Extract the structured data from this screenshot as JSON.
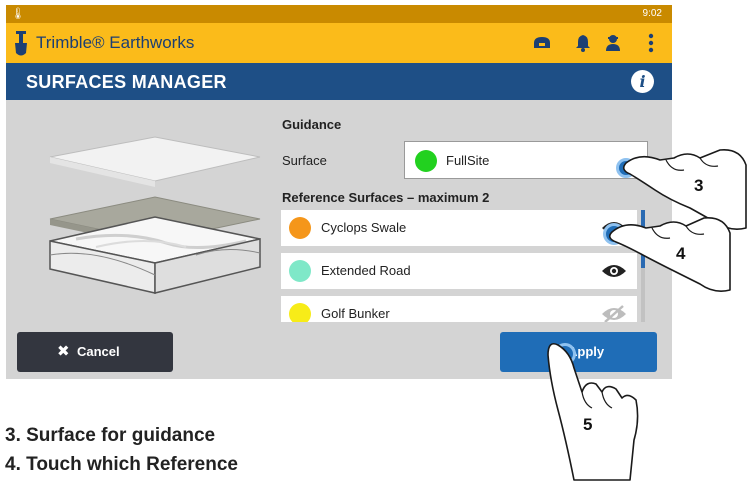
{
  "status_bar": {
    "time": "9:02"
  },
  "app_bar": {
    "title": "Trimble® Earthworks",
    "icons": [
      "scanner-icon",
      "bell-icon",
      "person-icon",
      "kebab-menu-icon"
    ]
  },
  "header": {
    "title": "SURFACES MANAGER",
    "info_icon": "info-icon",
    "info_glyph": "i"
  },
  "guidance": {
    "section_title": "Guidance",
    "surface_label": "Surface",
    "surface_value": "FullSite",
    "surface_color": "#22d11f"
  },
  "references": {
    "section_title": "Reference Surfaces – maximum 2",
    "items": [
      {
        "name": "Cyclops Swale",
        "color": "#f5961a",
        "visibility": "visible"
      },
      {
        "name": "Extended Road",
        "color": "#7fe8c8",
        "visibility": "visible"
      },
      {
        "name": "Golf Bunker",
        "color": "#f7ec18",
        "visibility": "hidden"
      }
    ]
  },
  "buttons": {
    "cancel_label": "Cancel",
    "cancel_icon": "✖",
    "apply_label": "Apply"
  },
  "callouts": {
    "step3": "3",
    "step4": "4",
    "step5": "5"
  },
  "captions": [
    "3. Surface for guidance",
    "4. Touch which Reference"
  ]
}
